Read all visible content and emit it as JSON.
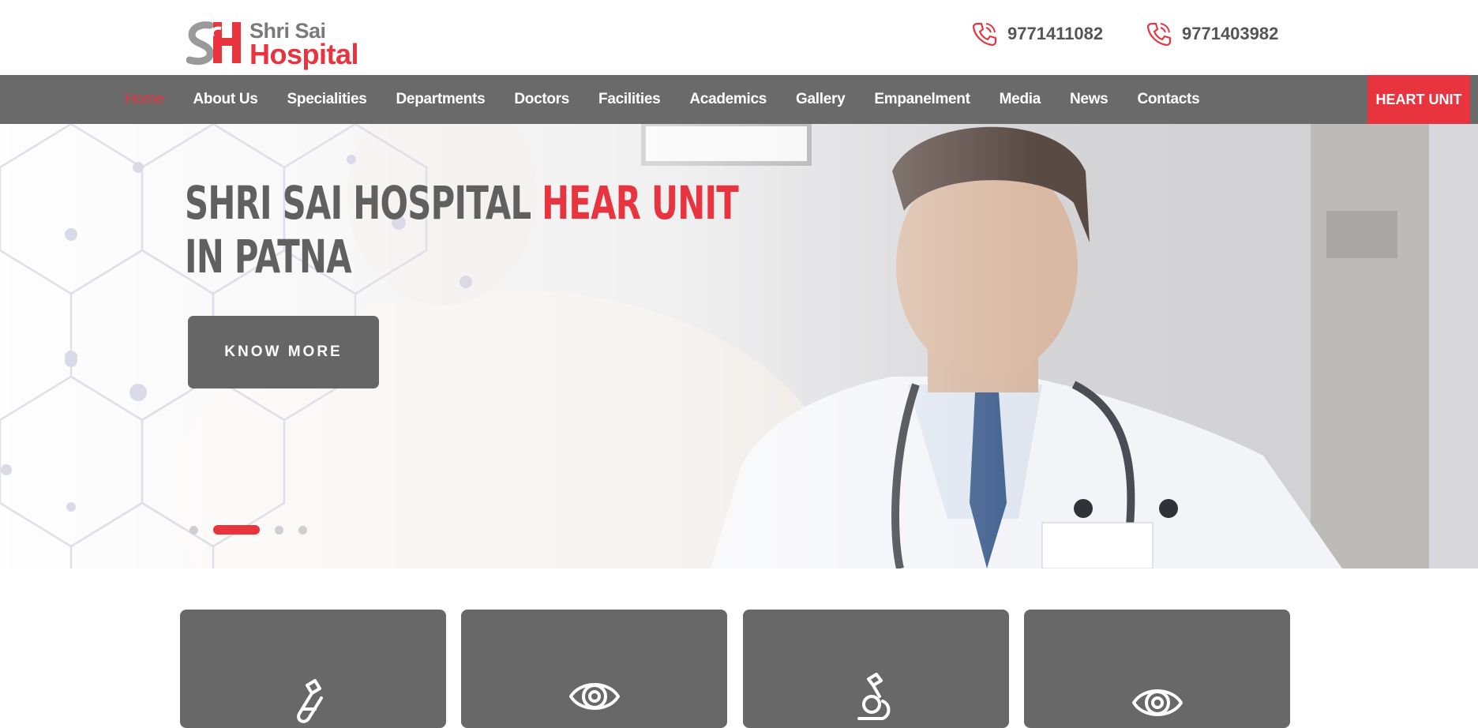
{
  "brand": {
    "name_top": "Shri Sai",
    "name_bottom": "Hospital",
    "logo_icon": "sh-monogram-logo",
    "accent_color": "#e7343f",
    "gray_color": "#6a6a6a"
  },
  "contacts": [
    {
      "icon": "phone-icon",
      "number": "9771411082"
    },
    {
      "icon": "phone-icon",
      "number": "9771403982"
    }
  ],
  "nav": {
    "items": [
      {
        "label": "Home",
        "active": true
      },
      {
        "label": "About Us"
      },
      {
        "label": "Specialities"
      },
      {
        "label": "Departments"
      },
      {
        "label": "Doctors"
      },
      {
        "label": "Facilities"
      },
      {
        "label": "Academics"
      },
      {
        "label": "Gallery"
      },
      {
        "label": "Empanelment"
      },
      {
        "label": "Media"
      },
      {
        "label": "News"
      },
      {
        "label": "Contacts"
      }
    ],
    "cta_label": "HEART UNIT"
  },
  "hero": {
    "title_part1": "SHRI SAI HOSPITAL ",
    "title_highlight": "HEAR UNIT",
    "title_line2": "IN PATNA",
    "button_label": "KNOW MORE",
    "slides_total": 4,
    "active_slide": 2,
    "image": "doctor-with-stethoscope-photo"
  },
  "cards": [
    {
      "icon": "test-tube-icon"
    },
    {
      "icon": "eye-icon"
    },
    {
      "icon": "microscope-icon"
    },
    {
      "icon": "eye-icon"
    }
  ]
}
